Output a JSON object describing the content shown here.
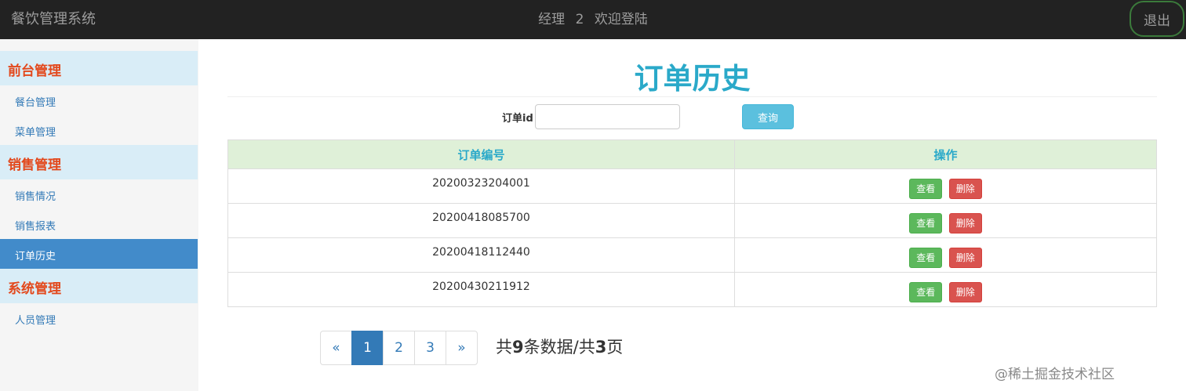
{
  "header": {
    "brand": "餐饮管理系统",
    "role": "经理",
    "user_id": "2",
    "welcome": "欢迎登陆",
    "logout_label": "退出"
  },
  "sidebar": {
    "sections": [
      {
        "title": "前台管理",
        "items": [
          "餐台管理",
          "菜单管理"
        ]
      },
      {
        "title": "销售管理",
        "items": [
          "销售情况",
          "销售报表",
          "订单历史"
        ]
      },
      {
        "title": "系统管理",
        "items": [
          "人员管理"
        ]
      }
    ],
    "active_item": "订单历史"
  },
  "main": {
    "title": "订单历史",
    "search": {
      "label": "订单id",
      "value": "",
      "placeholder": "",
      "button_label": "查询"
    },
    "table": {
      "headers": [
        "订单编号",
        "操作"
      ],
      "rows": [
        {
          "order_no": "20200323204001"
        },
        {
          "order_no": "20200418085700"
        },
        {
          "order_no": "20200418112440"
        },
        {
          "order_no": "20200430211912"
        }
      ],
      "view_label": "查看",
      "delete_label": "删除"
    },
    "pagination": {
      "prev": "«",
      "pages": [
        "1",
        "2",
        "3"
      ],
      "next": "»",
      "current": "1",
      "info_prefix": "共",
      "total_records": "9",
      "info_mid": "条数据/共",
      "total_pages": "3",
      "info_suffix": "页"
    }
  },
  "watermark": {
    "prefix": "https://blog.csdn.net/...",
    "text": "@稀土掘金技术社区"
  },
  "colors": {
    "topbar": "#222222",
    "section_bg": "#d9edf7",
    "section_text": "#e3481c",
    "active_item_bg": "#428bca",
    "title": "#2aa9c9",
    "table_header_bg": "#dff0d8",
    "view_button": "#5cb85c",
    "delete_button": "#d9534f",
    "search_button": "#5bc0de"
  }
}
